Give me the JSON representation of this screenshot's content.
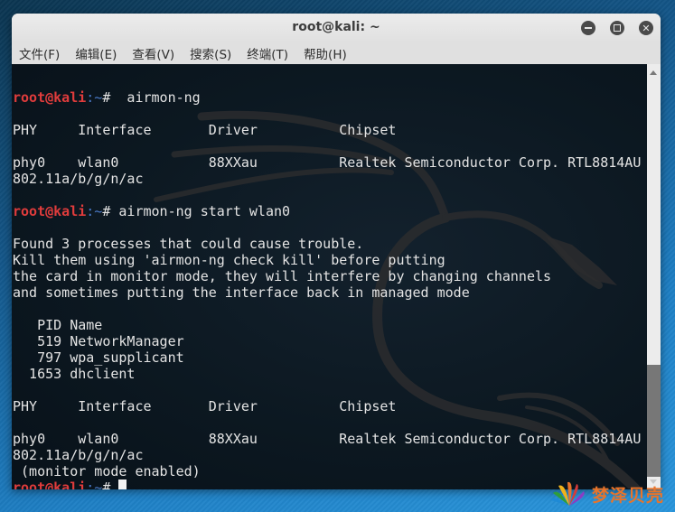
{
  "window": {
    "title": "root@kali: ~",
    "controls": {
      "minimize": "minimize-icon",
      "maximize": "maximize-icon",
      "close": "close-icon"
    }
  },
  "menu": [
    {
      "label": "文件(F)"
    },
    {
      "label": "编辑(E)"
    },
    {
      "label": "查看(V)"
    },
    {
      "label": "搜索(S)"
    },
    {
      "label": "终端(T)"
    },
    {
      "label": "帮助(H)"
    }
  ],
  "prompt": {
    "user_host": "root@kali",
    "path": ":~",
    "symbol": "#"
  },
  "terminal_lines": [
    {
      "type": "blank",
      "text": ""
    },
    {
      "type": "prompt",
      "text": "  airmon-ng"
    },
    {
      "type": "blank",
      "text": ""
    },
    {
      "type": "output",
      "text": "PHY     Interface       Driver          Chipset"
    },
    {
      "type": "blank",
      "text": ""
    },
    {
      "type": "output",
      "text": "phy0    wlan0           88XXau          Realtek Semiconductor Corp. RTL8814AU"
    },
    {
      "type": "output",
      "text": "802.11a/b/g/n/ac"
    },
    {
      "type": "blank",
      "text": ""
    },
    {
      "type": "prompt",
      "text": " airmon-ng start wlan0"
    },
    {
      "type": "blank",
      "text": ""
    },
    {
      "type": "output",
      "text": "Found 3 processes that could cause trouble."
    },
    {
      "type": "output",
      "text": "Kill them using 'airmon-ng check kill' before putting"
    },
    {
      "type": "output",
      "text": "the card in monitor mode, they will interfere by changing channels"
    },
    {
      "type": "output",
      "text": "and sometimes putting the interface back in managed mode"
    },
    {
      "type": "blank",
      "text": ""
    },
    {
      "type": "output",
      "text": "   PID Name"
    },
    {
      "type": "output",
      "text": "   519 NetworkManager"
    },
    {
      "type": "output",
      "text": "   797 wpa_supplicant"
    },
    {
      "type": "output",
      "text": "  1653 dhclient"
    },
    {
      "type": "blank",
      "text": ""
    },
    {
      "type": "output",
      "text": "PHY     Interface       Driver          Chipset"
    },
    {
      "type": "blank",
      "text": ""
    },
    {
      "type": "output",
      "text": "phy0    wlan0           88XXau          Realtek Semiconductor Corp. RTL8814AU"
    },
    {
      "type": "output",
      "text": "802.11a/b/g/n/ac"
    },
    {
      "type": "output",
      "text": " (monitor mode enabled)"
    },
    {
      "type": "prompt_active",
      "text": " "
    }
  ],
  "scrollbar": {
    "position_fraction": 0.72,
    "visible_fraction": 0.28
  },
  "watermark": {
    "text": "梦泽贝壳"
  }
}
